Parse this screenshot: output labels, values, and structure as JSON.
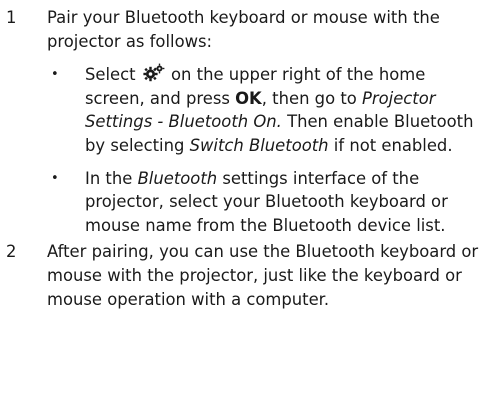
{
  "steps": [
    {
      "number": "1",
      "text": "Pair your Bluetooth keyboard or mouse with the projector as follows:",
      "bullets": [
        {
          "marker": "•",
          "select": "Select",
          "icon": "settings-gear-icon",
          "after_icon": "on the upper right of the home screen, and press",
          "ok": "OK",
          "then_go": ", then go to",
          "path": "Projector Settings - Bluetooth On.",
          "then_enable": "Then enable Bluetooth by selecting",
          "switch": "Switch Bluetooth",
          "if_not": "if not enabled."
        },
        {
          "marker": "•",
          "in_the": "In the",
          "bt_settings": "Bluetooth",
          "rest": "settings interface of the projector, select your Bluetooth keyboard or mouse name from the Bluetooth device list."
        }
      ]
    },
    {
      "number": "2",
      "text": "After pairing, you can use the Bluetooth keyboard or mouse with the projector, just like the keyboard or mouse operation with a computer."
    }
  ]
}
